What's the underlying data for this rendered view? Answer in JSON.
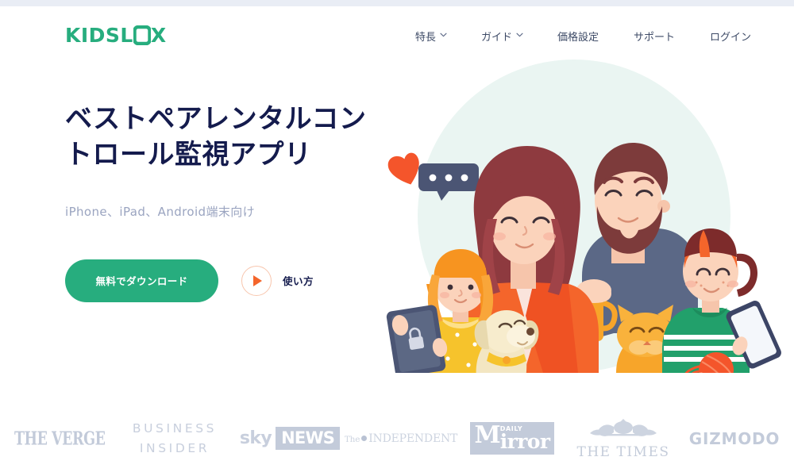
{
  "brand": {
    "logo_text": "KIDSLOX",
    "logo_icon": "padlock-icon",
    "green": "#27ad7e",
    "navy": "#141b4d",
    "orange": "#f4652b"
  },
  "nav": {
    "items": [
      {
        "label": "特長",
        "has_chevron": true,
        "icon": "chevron-down-icon"
      },
      {
        "label": "ガイド",
        "has_chevron": true,
        "icon": "chevron-down-icon"
      },
      {
        "label": "価格設定",
        "has_chevron": false
      },
      {
        "label": "サポート",
        "has_chevron": false
      },
      {
        "label": "ログイン",
        "has_chevron": false
      }
    ]
  },
  "hero": {
    "headline_line1": "ベストペアレンタルコン",
    "headline_line2": "トロール監視アプリ",
    "subtitle": "iPhone、iPad、Android端末向け",
    "download_button": "無料でダウンロード",
    "video_label": "使い方",
    "video_icon": "play-icon",
    "illustration": "family-with-devices-illustration",
    "illustration_elements": [
      "mint-circle-backdrop",
      "heart-icon",
      "chat-bubble-icon",
      "girl-with-tablet",
      "mother",
      "father-with-mug",
      "boy-with-phone",
      "dog",
      "cat",
      "yarn-ball",
      "tablet-lock-icon"
    ]
  },
  "press": {
    "logos": [
      {
        "name": "the-verge-logo",
        "text": "THE VERGE"
      },
      {
        "name": "business-insider-logo",
        "line1": "BUSINESS",
        "line2": "INSIDER"
      },
      {
        "name": "sky-news-logo",
        "text1": "sky",
        "text2": "NEWS"
      },
      {
        "name": "the-independent-logo",
        "the": "The",
        "text": "INDEPENDENT"
      },
      {
        "name": "daily-mirror-logo",
        "m": "M",
        "daily": "DAILY",
        "rest": "irror"
      },
      {
        "name": "the-times-logo",
        "text": "THE TIMES",
        "crest": "royal-crest-icon"
      },
      {
        "name": "gizmodo-logo",
        "text": "GIZMODO"
      }
    ]
  }
}
